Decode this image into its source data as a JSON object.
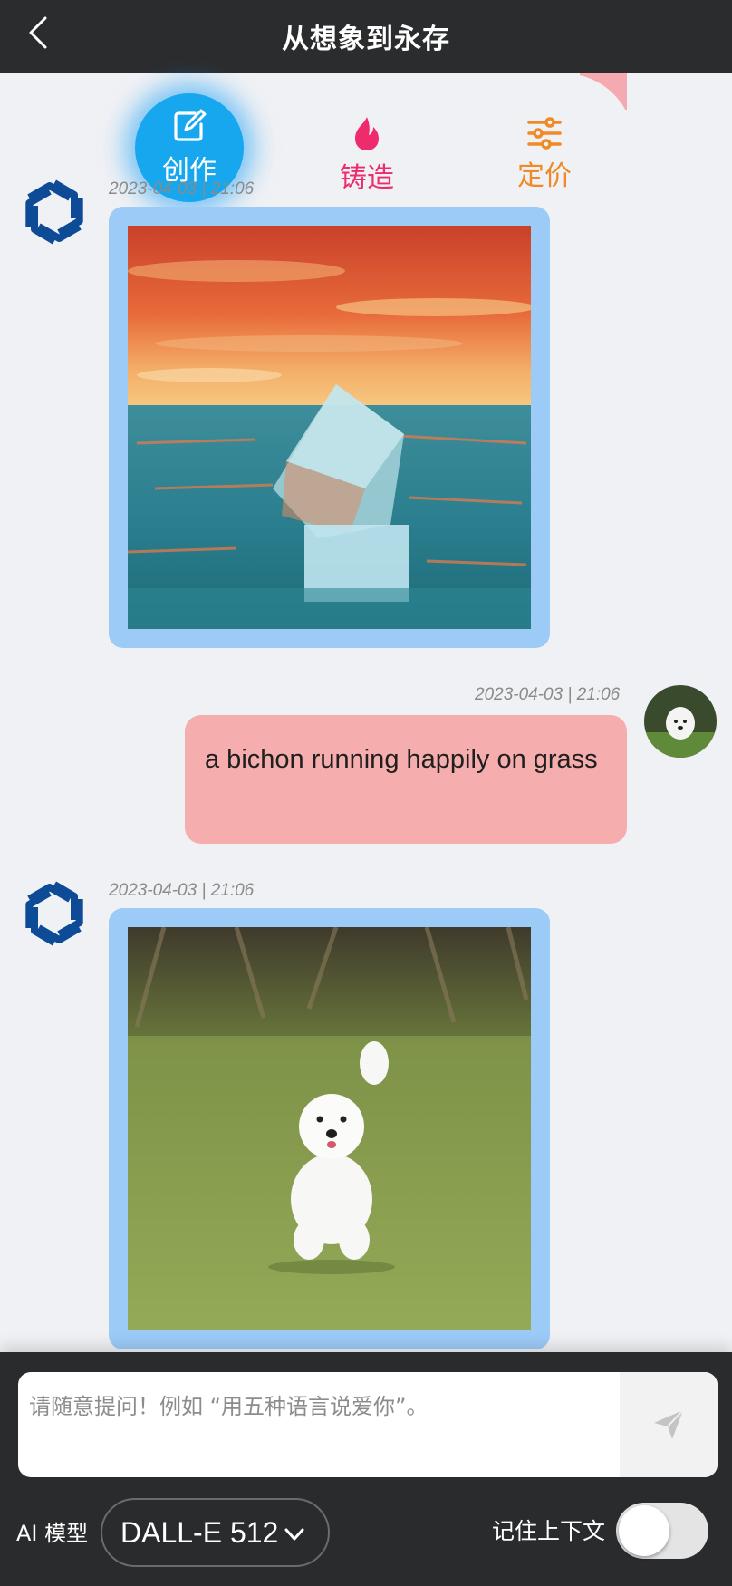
{
  "header": {
    "title": "从想象到永存",
    "back_icon": "chevron-left-icon"
  },
  "tabs": [
    {
      "label": "创作",
      "icon": "edit-icon",
      "color": "#ffffff",
      "active": true
    },
    {
      "label": "铸造",
      "icon": "flame-icon",
      "color": "#ee2b6c"
    },
    {
      "label": "定价",
      "icon": "sliders-icon",
      "color": "#ef8a26"
    }
  ],
  "messages": [
    {
      "sender": "bot",
      "avatar": "openai-logo-icon",
      "timestamp": "2023-04-03 | 21:06",
      "type": "image",
      "image_desc": "ice-cube-in-ocean-sunset"
    },
    {
      "sender": "user",
      "avatar": "user-avatar-bichon",
      "timestamp": "2023-04-03 | 21:06",
      "type": "text",
      "text": "a bichon running happily on grass"
    },
    {
      "sender": "bot",
      "avatar": "openai-logo-icon",
      "timestamp": "2023-04-03 | 21:06",
      "type": "image",
      "image_desc": "bichon-running-on-grass"
    }
  ],
  "composer": {
    "placeholder": "请随意提问！例如 “用五种语言说爱你”。",
    "send_icon": "send-icon"
  },
  "model": {
    "label": "AI 模型",
    "value": "DALL-E 512",
    "icon": "chevron-down-icon"
  },
  "context": {
    "label": "记住上下文",
    "enabled": false
  },
  "colors": {
    "accent": "#16a7ee",
    "bubble_image": "#9ccbf8",
    "bubble_user": "#f6adad",
    "bar": "#2b2c2e"
  }
}
